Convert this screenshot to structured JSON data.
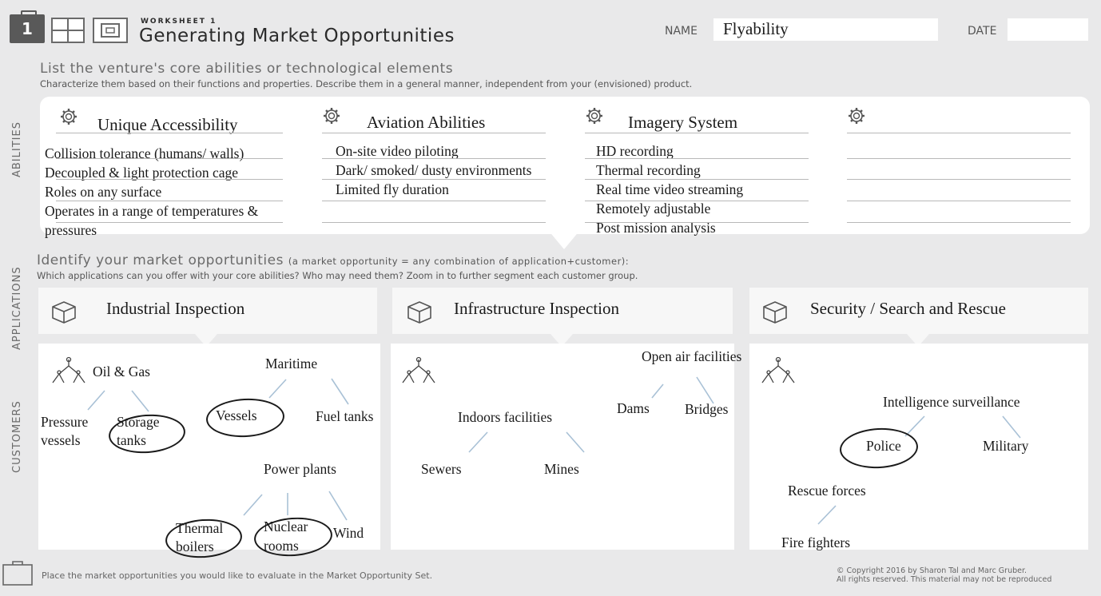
{
  "header": {
    "worksheet_number": "1",
    "worksheet_label": "WORKSHEET 1",
    "title": "Generating Market Opportunities",
    "name_label": "NAME",
    "name_value": "Flyability",
    "date_label": "DATE",
    "date_value": ""
  },
  "abilities_section": {
    "side_label": "ABILITIES",
    "title": "List the venture's core abilities or technological elements",
    "subtitle": "Characterize them based on their functions and properties. Describe them in a general manner, independent from your (envisioned) product.",
    "columns": [
      {
        "heading": "Unique Accessibility",
        "items": [
          "Collision tolerance (humans/ walls)",
          "Decoupled & light protection cage",
          "Roles on any surface",
          "Operates in a range of temperatures &",
          "pressures"
        ]
      },
      {
        "heading": "Aviation Abilities",
        "items": [
          "On-site video piloting",
          "Dark/ smoked/ dusty environments",
          "Limited fly duration"
        ]
      },
      {
        "heading": "Imagery System",
        "items": [
          "HD recording",
          "Thermal recording",
          "Real time video streaming",
          "Remotely adjustable",
          "Post mission analysis"
        ]
      },
      {
        "heading": "",
        "items": []
      }
    ]
  },
  "market_section": {
    "applications_side_label": "APPLICATIONS",
    "customers_side_label": "CUSTOMERS",
    "title": "Identify your market opportunities",
    "title_note": "(a market opportunity = any combination of application+customer):",
    "subtitle": "Which applications can you offer with your core abilities? Who may need them? Zoom in to further segment each customer group.",
    "applications": [
      {
        "title": "Industrial Inspection",
        "customers": {
          "oil_gas": "Oil & Gas",
          "pressure_vessels_1": "Pressure",
          "pressure_vessels_2": "vessels",
          "storage_tanks_1": "Storage",
          "storage_tanks_2": "tanks",
          "maritime": "Maritime",
          "vessels": "Vessels",
          "fuel_tanks": "Fuel tanks",
          "power_plants": "Power plants",
          "thermal_boilers_1": "Thermal",
          "thermal_boilers_2": "boilers",
          "nuclear_rooms_1": "Nuclear",
          "nuclear_rooms_2": "rooms",
          "wind": "Wind"
        }
      },
      {
        "title": "Infrastructure Inspection",
        "customers": {
          "open_air": "Open air facilities",
          "dams": "Dams",
          "bridges": "Bridges",
          "indoors": "Indoors facilities",
          "sewers": "Sewers",
          "mines": "Mines"
        }
      },
      {
        "title": "Security / Search and Rescue",
        "customers": {
          "intelligence": "Intelligence surveillance",
          "police": "Police",
          "military": "Military",
          "rescue_forces": "Rescue forces",
          "fire_fighters": "Fire fighters"
        }
      }
    ]
  },
  "footer": {
    "instruction": "Place the market opportunities you would like to evaluate in the Market Opportunity Set.",
    "copyright_1": "© Copyright 2016 by Sharon Tal and Marc Gruber.",
    "copyright_2": "All rights reserved. This material may not be reproduced"
  },
  "colors": {
    "background": "#e9e9ea",
    "panel": "#ffffff",
    "header_badge": "#595959",
    "handwriting": "#1a1a1a"
  },
  "icons": [
    "briefcase-icon",
    "gear-icon",
    "cube-icon",
    "tree-icon"
  ]
}
